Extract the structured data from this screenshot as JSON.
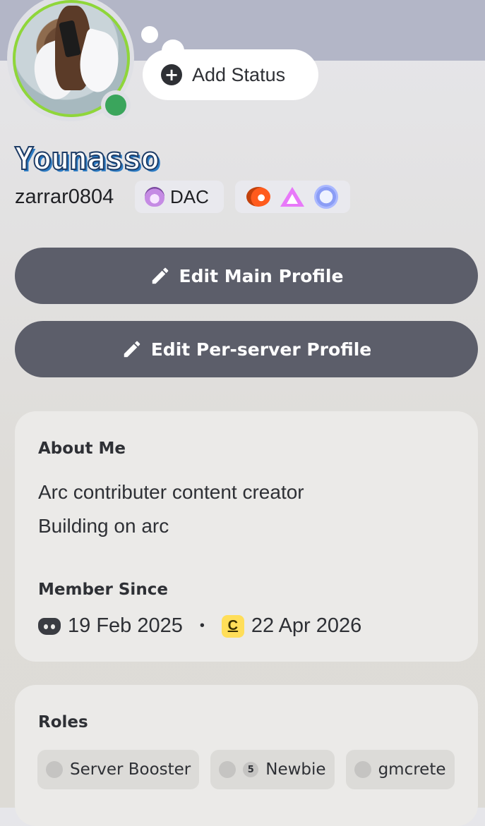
{
  "status": {
    "add_label": "Add Status"
  },
  "profile": {
    "display_name": "Younasso",
    "username": "zarrar0804",
    "clan_tag": "DAC",
    "online_status": "online"
  },
  "badges": [
    "nitro-boost-badge",
    "quest-badge",
    "hypesquad-badge"
  ],
  "buttons": {
    "edit_main": "Edit Main Profile",
    "edit_server": "Edit Per-server Profile"
  },
  "about": {
    "title": "About Me",
    "lines": [
      "Arc contributer content creator",
      "Building on arc"
    ]
  },
  "member_since": {
    "title": "Member Since",
    "discord_date": "19 Feb 2025",
    "server_date": "22 Apr 2026",
    "server_icon_letter": "C"
  },
  "roles": {
    "title": "Roles",
    "items": [
      {
        "label": "Server Booster",
        "level": ""
      },
      {
        "label": "Newbie",
        "level": "5"
      },
      {
        "label": "gmcrete",
        "level": ""
      }
    ]
  },
  "colors": {
    "banner": "#b3b6c7",
    "button": "#5c5e6a",
    "online": "#3aa55c",
    "avatar_ring": "#8fd63a"
  }
}
